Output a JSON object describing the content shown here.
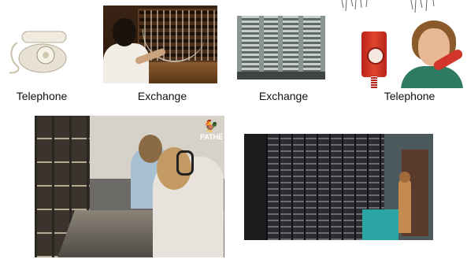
{
  "captions": {
    "phone_left": "Telephone",
    "exchange_1": "Exchange",
    "exchange_2": "Exchange",
    "phone_right": "Telephone"
  },
  "images": {
    "phone_left": "rotary-telephone",
    "switchboard": "switchboard-operator",
    "exchange_racks": "exchange-equipment-racks",
    "phone_right": "woman-on-red-wall-phone",
    "operators_room": "telephone-operators-room",
    "exchange_corridor": "exchange-corridor"
  },
  "watermark": {
    "brand": "BRITISH PATHÉ",
    "short": "PATHÉ"
  },
  "colors": {
    "phone_left": "#eeeae0",
    "red_phone": "#d2362a",
    "teal_desk": "#2aa4a4"
  }
}
